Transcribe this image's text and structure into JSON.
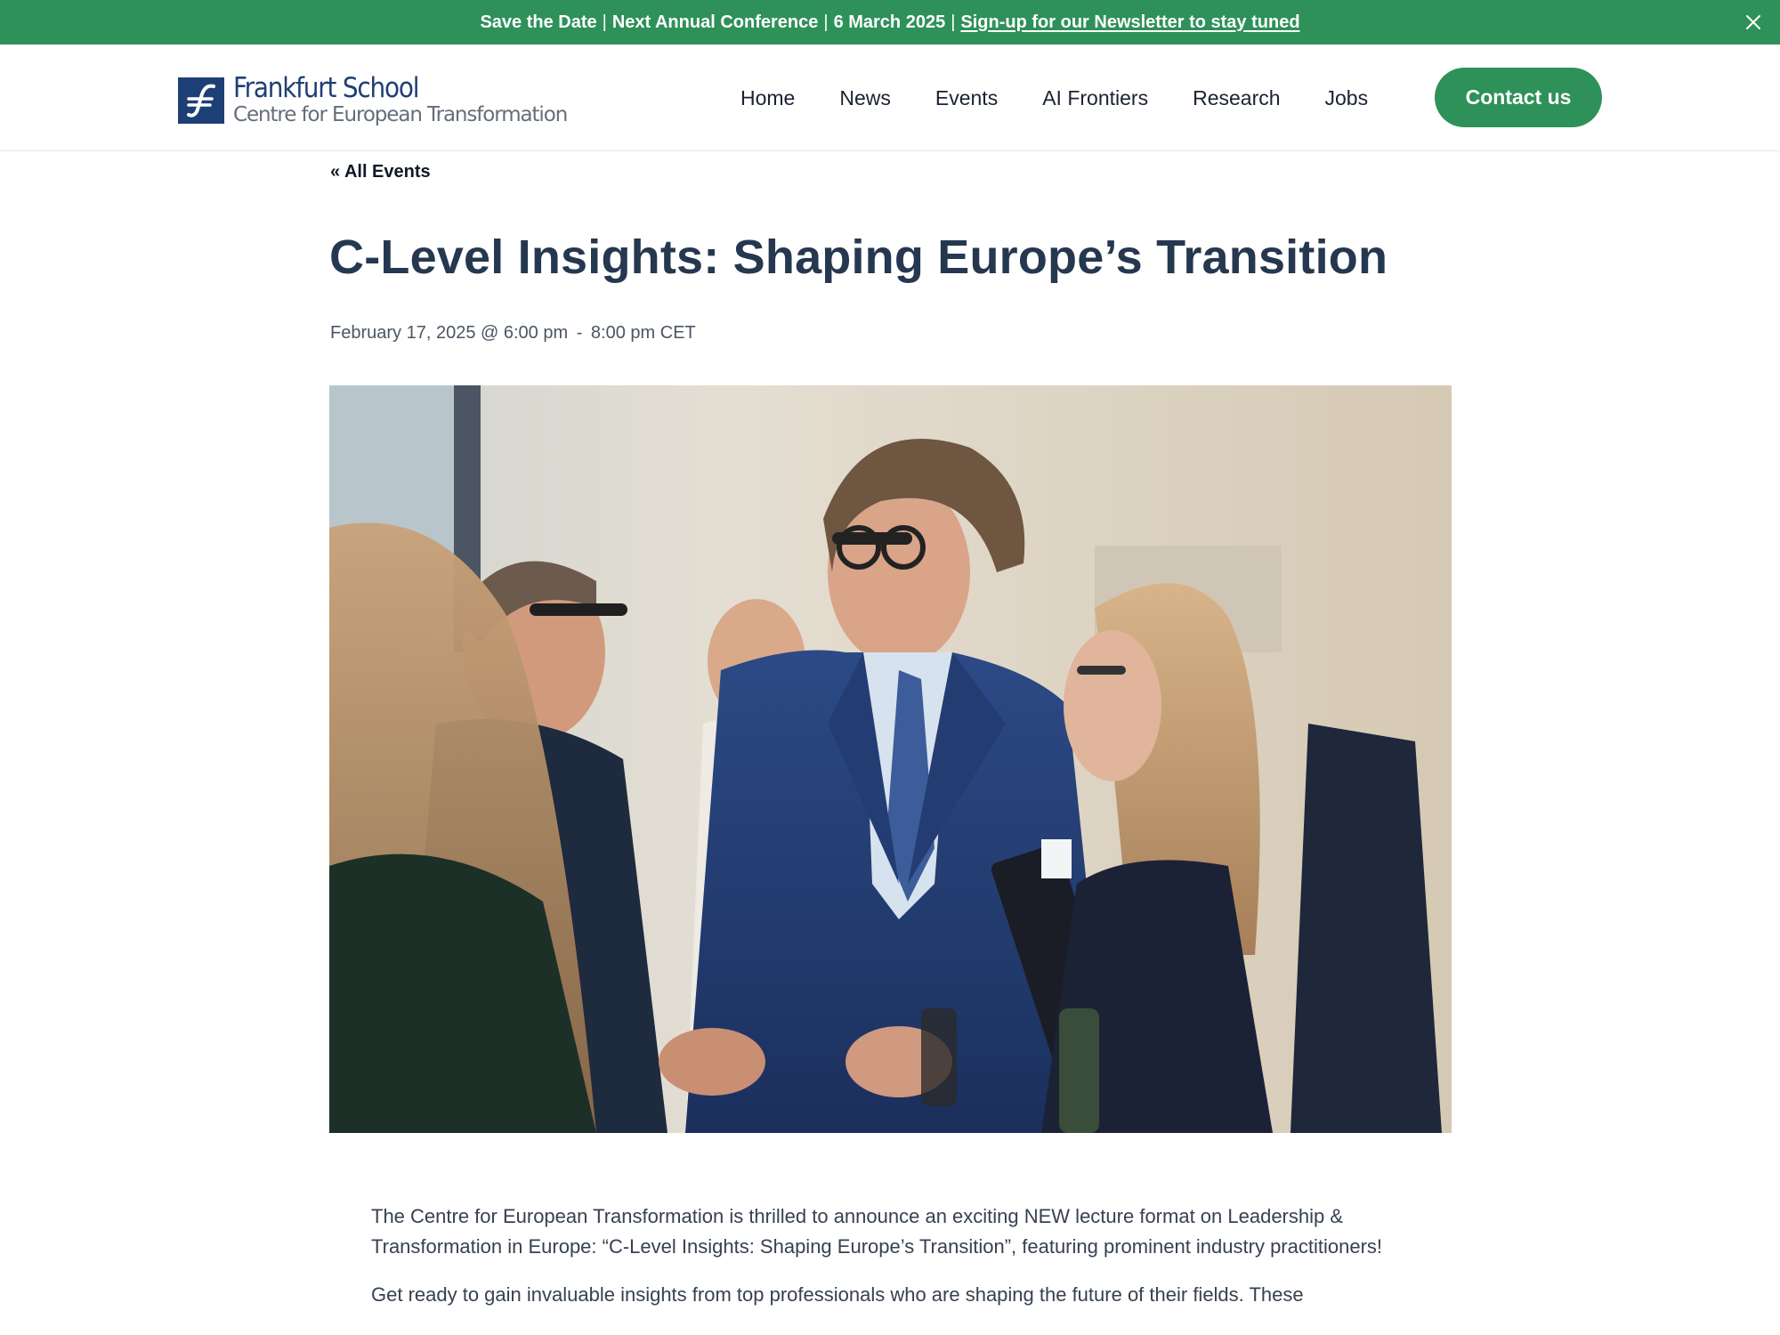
{
  "announcement": {
    "parts": [
      "Save the Date",
      "Next Annual Conference",
      "6 March 2025"
    ],
    "separator": "|",
    "link_text": "Sign-up for our Newsletter to stay tuned",
    "close_icon": "close-icon"
  },
  "header": {
    "logo": {
      "line1": "Frankfurt School",
      "line2": "Centre for European Transformation",
      "mark_glyph": "∱"
    },
    "nav": [
      "Home",
      "News",
      "Events",
      "AI Frontiers",
      "Research",
      "Jobs"
    ],
    "contact_label": "Contact us"
  },
  "event": {
    "back_link": "« All Events",
    "title": "C-Level Insights: Shaping Europe’s Transition",
    "date": "February 17, 2025 @ 6:00 pm",
    "date_sep": "-",
    "end_time": "8:00 pm",
    "timezone": "CET",
    "image_alt": "Business professionals networking at an event",
    "paragraphs": [
      "The Centre for European Transformation is thrilled to announce an exciting NEW lecture format on Leadership & Transformation in Europe: “C-Level Insights: Shaping Europe’s Transition”, featuring prominent industry practitioners!",
      "Get ready to gain invaluable insights from top professionals who are shaping the future of their fields. These"
    ]
  },
  "colors": {
    "brand_green": "#2e9159",
    "brand_navy": "#1e3f75",
    "title": "#263750"
  }
}
